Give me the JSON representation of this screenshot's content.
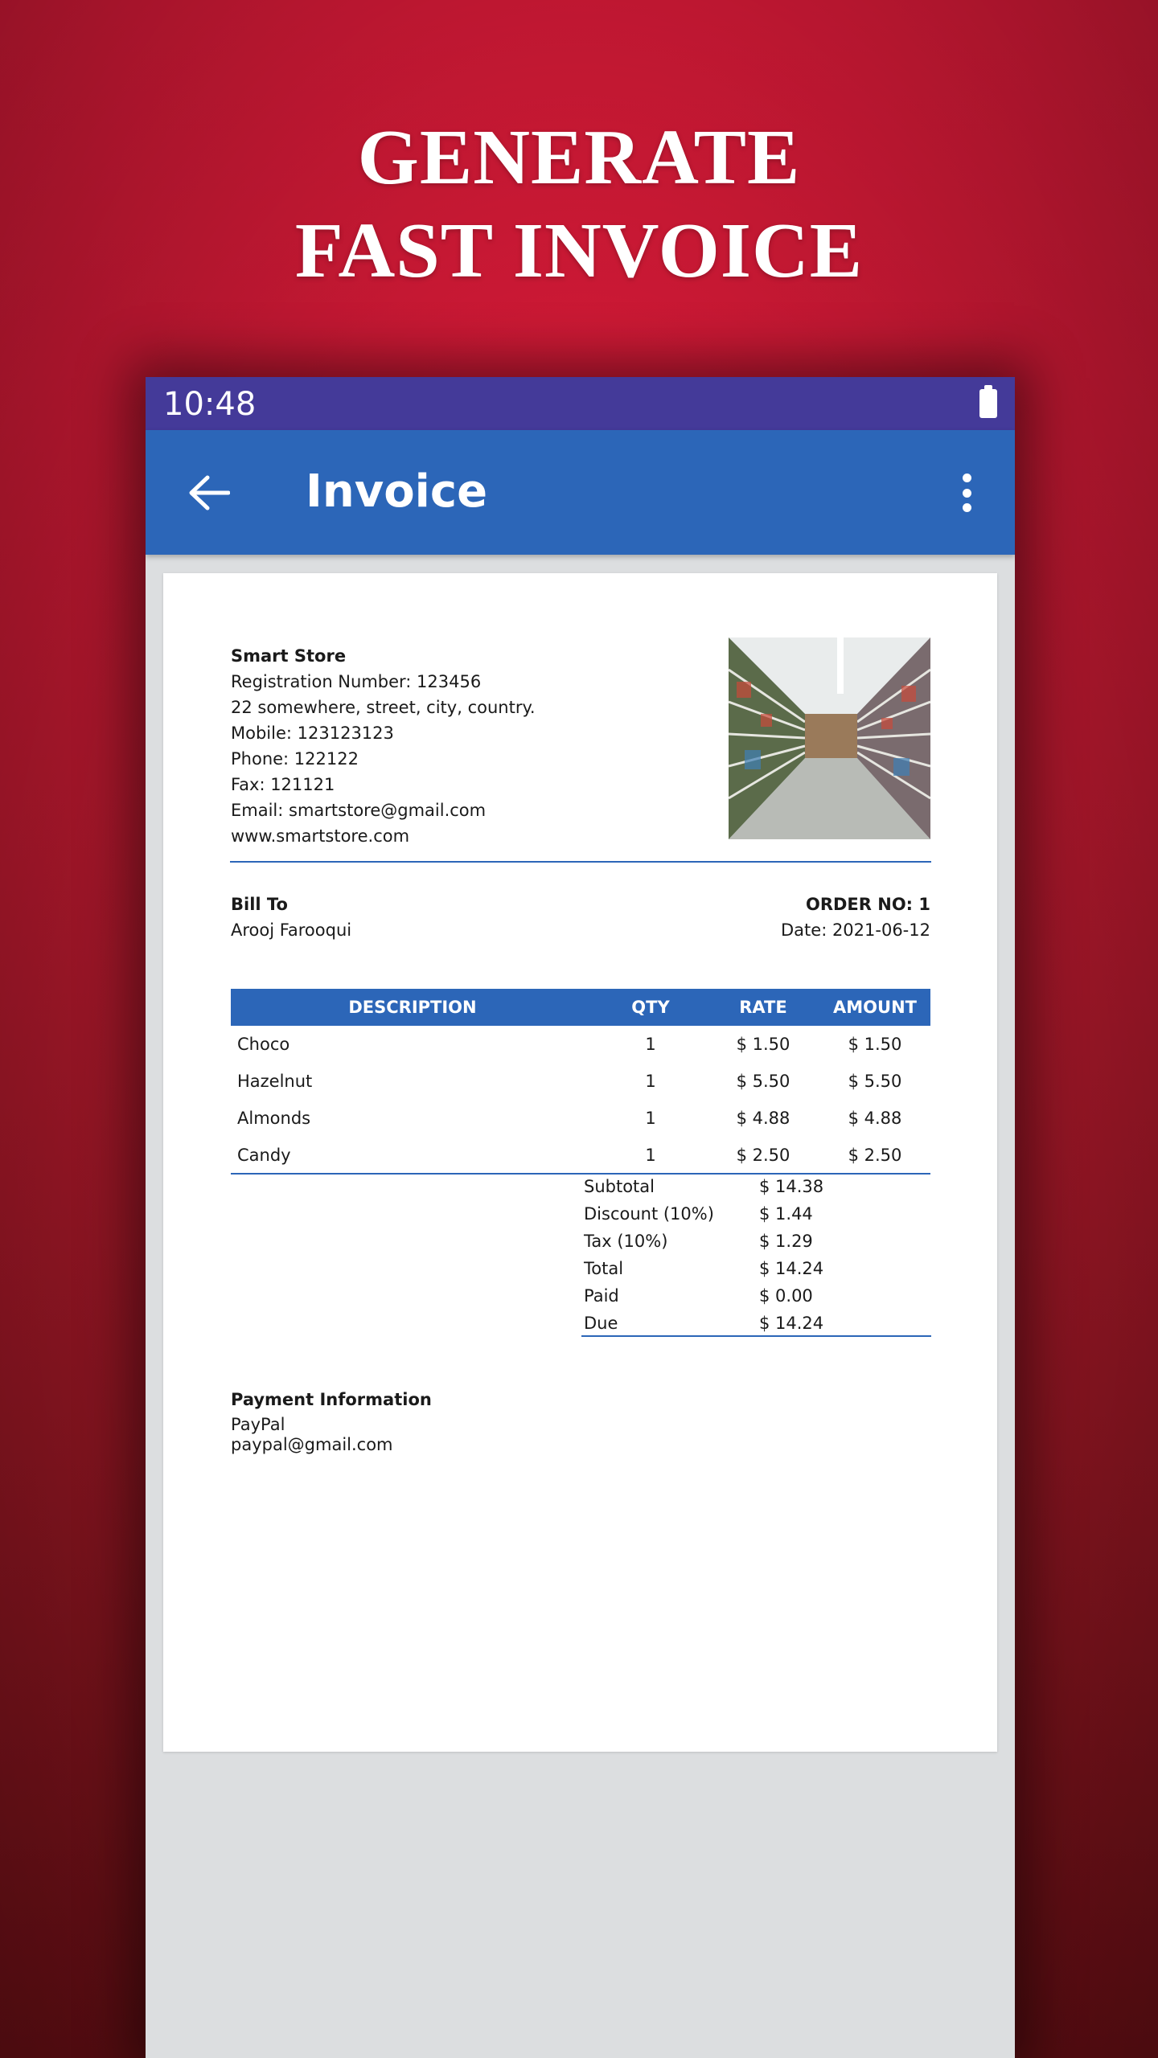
{
  "headline": {
    "line1": "GENERATE",
    "line2": "FAST INVOICE"
  },
  "status_bar": {
    "time": "10:48"
  },
  "app_bar": {
    "title": "Invoice"
  },
  "invoice": {
    "store": {
      "name": "Smart Store",
      "registration": "Registration Number: 123456",
      "address": "22 somewhere, street, city, country.",
      "mobile": "Mobile: 123123123",
      "phone": "Phone: 122122",
      "fax": "Fax: 121121",
      "email": "Email: smartstore@gmail.com",
      "website": "www.smartstore.com"
    },
    "bill_to": {
      "label": "Bill To",
      "name": "Arooj Farooqui"
    },
    "order": {
      "number": "ORDER NO: 1",
      "date": "Date: 2021-06-12"
    },
    "table": {
      "headers": [
        "DESCRIPTION",
        "QTY",
        "RATE",
        "AMOUNT"
      ],
      "rows": [
        [
          "Choco",
          "1",
          "$ 1.50",
          "$ 1.50"
        ],
        [
          "Hazelnut",
          "1",
          "$ 5.50",
          "$ 5.50"
        ],
        [
          "Almonds",
          "1",
          "$ 4.88",
          "$ 4.88"
        ],
        [
          "Candy",
          "1",
          "$ 2.50",
          "$ 2.50"
        ]
      ]
    },
    "totals": [
      {
        "label": "Subtotal",
        "value": "$ 14.38"
      },
      {
        "label": "Discount (10%)",
        "value": "$ 1.44"
      },
      {
        "label": "Tax (10%)",
        "value": "$ 1.29"
      },
      {
        "label": "Total",
        "value": "$ 14.24"
      },
      {
        "label": "Paid",
        "value": "$ 0.00"
      },
      {
        "label": "Due",
        "value": "$ 14.24"
      }
    ],
    "payment": {
      "title": "Payment Information",
      "method": "PayPal",
      "email": "paypal@gmail.com"
    }
  },
  "colors": {
    "brand_red": "#e81c3c",
    "status_bar": "#443a99",
    "app_bar": "#2c66b8",
    "accent_blue": "#2c66b8"
  },
  "icons": {
    "back": "arrow-left-icon",
    "menu": "more-vertical-icon",
    "battery": "battery-icon"
  }
}
